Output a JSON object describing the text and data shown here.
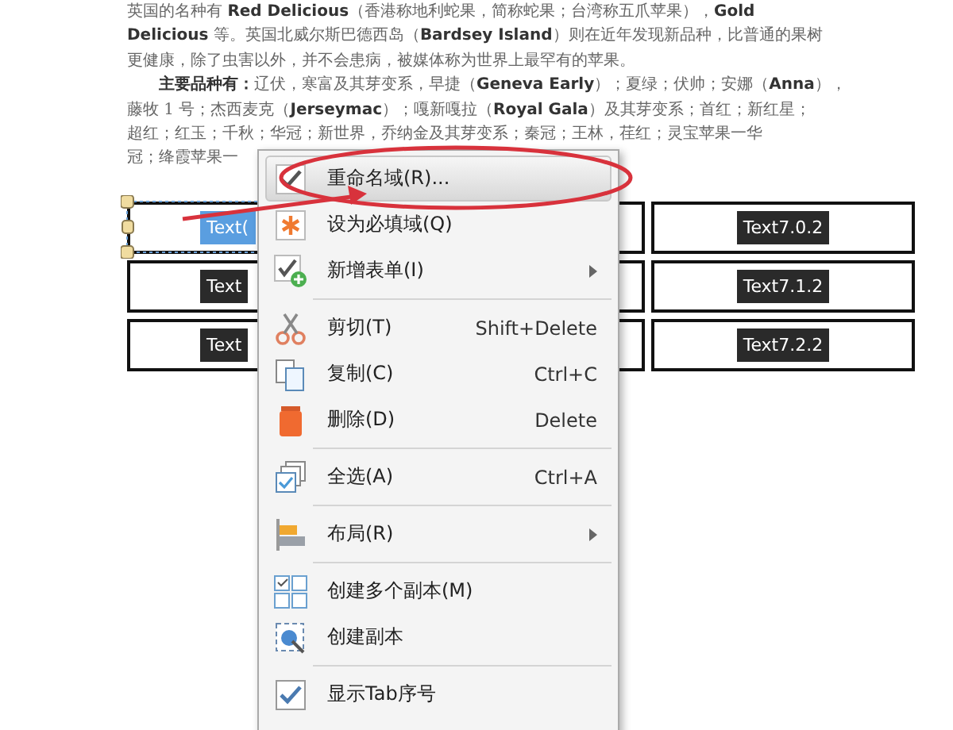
{
  "document": {
    "lines": [
      {
        "text": "英国的名种有 **Red Delicious**（香港称地利蛇果，简称蛇果；台湾称五爪苹果），**Gold**",
        "indent": false
      },
      {
        "text": "**Delicious** 等。英国北威尔斯巴德西岛（**Bardsey Island**）则在近年发现新品种，比普通的果树",
        "indent": false
      },
      {
        "text": "更健康，除了虫害以外，并不会患病，被媒体称为世界上最罕有的苹果。",
        "indent": false
      },
      {
        "text": "**主要品种有：**辽伏，寒富及其芽变系，早捷（**Geneva Early**）；夏绿；伏帅；安娜（**Anna**），",
        "indent": true
      },
      {
        "text": "藤牧 1 号；杰西麦克（**Jerseymac**）；嘎新嘎拉（**Royal Gala**）及其芽变系；首红；新红星；",
        "indent": false
      },
      {
        "text": "超红；红玉；千秋；华冠；新世界，乔纳金及其芽变系；秦冠；王林，荏红；灵宝苹果一华",
        "indent": false
      },
      {
        "text": "冠；绛霞苹果一",
        "indent": false
      }
    ]
  },
  "table": {
    "rows": [
      {
        "column_1": {
          "text": "Text(",
          "selected": true
        },
        "column_3": {
          "text": "Text7.0.2",
          "selected": false
        }
      },
      {
        "column_1": {
          "text": "Text",
          "selected": false
        },
        "column_3": {
          "text": "Text7.1.2",
          "selected": false
        }
      },
      {
        "column_1": {
          "text": "Text",
          "selected": false
        },
        "column_3": {
          "text": "Text7.2.2",
          "selected": false
        }
      }
    ]
  },
  "context_menu": {
    "items": [
      {
        "label": "重命名域(R)...",
        "highlighted": true,
        "submenu": false,
        "separator_after": false
      },
      {
        "label": "设为必填域(Q)",
        "highlighted": false,
        "submenu": false,
        "separator_after": false
      },
      {
        "label": "新增表单(I)",
        "highlighted": false,
        "submenu": true,
        "separator_after": true
      },
      {
        "label": "剪切(T)",
        "shortcut": "Shift+Delete",
        "highlighted": false,
        "submenu": false,
        "separator_after": false
      },
      {
        "label": "复制(C)",
        "shortcut": "Ctrl+C",
        "highlighted": false,
        "submenu": false,
        "separator_after": false
      },
      {
        "label": "删除(D)",
        "shortcut": "Delete",
        "highlighted": false,
        "submenu": false,
        "separator_after": true
      },
      {
        "label": "全选(A)",
        "shortcut": "Ctrl+A",
        "highlighted": false,
        "submenu": false,
        "separator_after": true
      },
      {
        "label": "布局(R)",
        "highlighted": false,
        "submenu": true,
        "separator_after": true
      },
      {
        "label": "创建多个副本(M)",
        "highlighted": false,
        "submenu": false,
        "separator_after": false
      },
      {
        "label": "创建副本",
        "highlighted": false,
        "submenu": false,
        "separator_after": true
      },
      {
        "label": "显示Tab序号",
        "highlighted": false,
        "submenu": false,
        "separator_after": false
      }
    ]
  }
}
